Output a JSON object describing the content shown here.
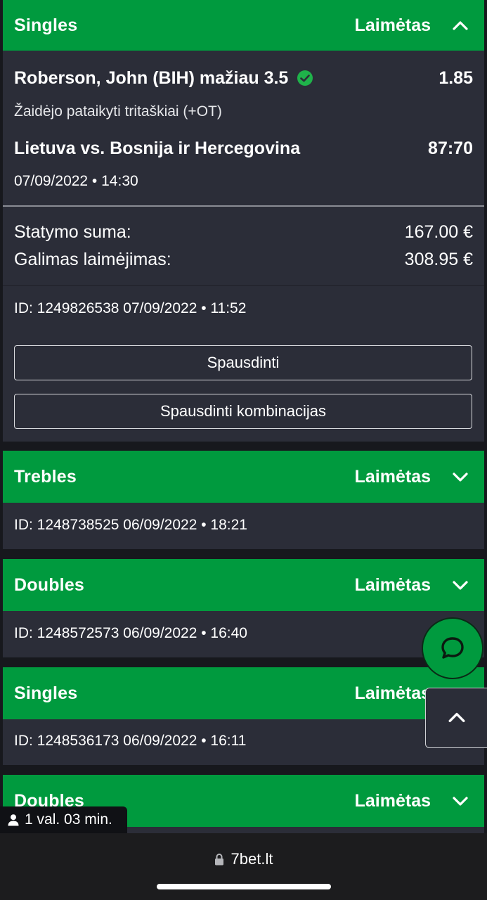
{
  "bets": [
    {
      "type": "Singles",
      "status": "Laimėtas",
      "expanded": true,
      "selection": {
        "pick": "Roberson, John (BIH) mažiau 3.5",
        "odds": "1.85",
        "market": "Žaidėjo pataikyti tritaškiai (+OT)",
        "event": "Lietuva vs. Bosnija ir Hercegovina",
        "score": "87:70",
        "event_time": "07/09/2022 • 14:30"
      },
      "stake_label": "Statymo suma:",
      "stake_value": "167.00 €",
      "payout_label": "Galimas laimėjimas:",
      "payout_value": "308.95 €",
      "id_line": "ID: 1249826538  07/09/2022 • 11:52",
      "print_label": "Spausdinti",
      "print_combos_label": "Spausdinti kombinacijas"
    },
    {
      "type": "Trebles",
      "status": "Laimėtas",
      "id_line": "ID: 1248738525  06/09/2022 • 18:21"
    },
    {
      "type": "Doubles",
      "status": "Laimėtas",
      "id_line": "ID: 1248572573  06/09/2022 • 16:40"
    },
    {
      "type": "Singles",
      "status": "Laimėtas",
      "id_line": "ID: 1248536173  06/09/2022 • 16:11"
    },
    {
      "type": "Doubles",
      "status": "Laimėtas"
    }
  ],
  "session_time": "1 val. 03 min.",
  "browser": {
    "url": "7bet.lt"
  },
  "colors": {
    "accent": "#009a3e",
    "card_bg": "#2b2d38",
    "page_bg": "#17181d"
  },
  "icons": [
    "chevron-up-icon",
    "chevron-down-icon",
    "check-circle-icon",
    "chat-icon",
    "lock-icon",
    "user-icon"
  ]
}
